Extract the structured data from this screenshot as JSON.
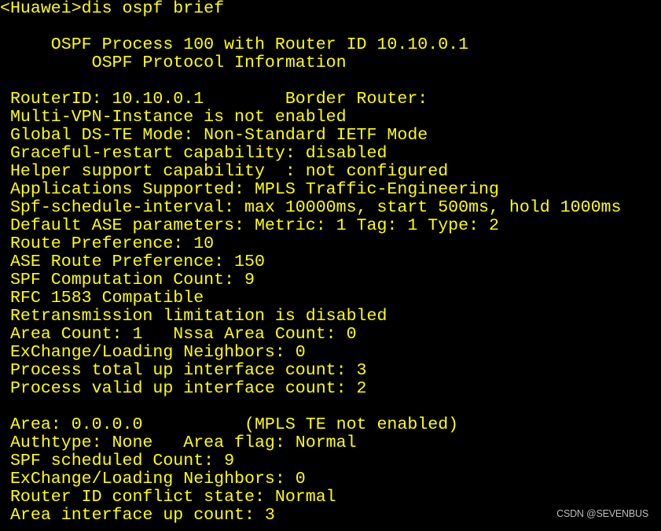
{
  "terminal": {
    "text_color": "#ffff00",
    "background_color": "#000000",
    "prompt": "<Huawei>",
    "command": "dis ospf brief",
    "lines": [
      "<Huawei>dis ospf brief",
      "",
      "     OSPF Process 100 with Router ID 10.10.0.1",
      "         OSPF Protocol Information",
      "",
      " RouterID: 10.10.0.1        Border Router:",
      " Multi-VPN-Instance is not enabled",
      " Global DS-TE Mode: Non-Standard IETF Mode",
      " Graceful-restart capability: disabled",
      " Helper support capability  : not configured",
      " Applications Supported: MPLS Traffic-Engineering",
      " Spf-schedule-interval: max 10000ms, start 500ms, hold 1000ms",
      " Default ASE parameters: Metric: 1 Tag: 1 Type: 2",
      " Route Preference: 10",
      " ASE Route Preference: 150",
      " SPF Computation Count: 9",
      " RFC 1583 Compatible",
      " Retransmission limitation is disabled",
      " Area Count: 1   Nssa Area Count: 0",
      " ExChange/Loading Neighbors: 0",
      " Process total up interface count: 3",
      " Process valid up interface count: 2",
      "",
      " Area: 0.0.0.0          (MPLS TE not enabled)",
      " Authtype: None   Area flag: Normal",
      " SPF scheduled Count: 9",
      " ExChange/Loading Neighbors: 0",
      " Router ID conflict state: Normal",
      " Area interface up count: 3"
    ]
  },
  "watermark": {
    "text": "CSDN @SEVENBUS"
  }
}
